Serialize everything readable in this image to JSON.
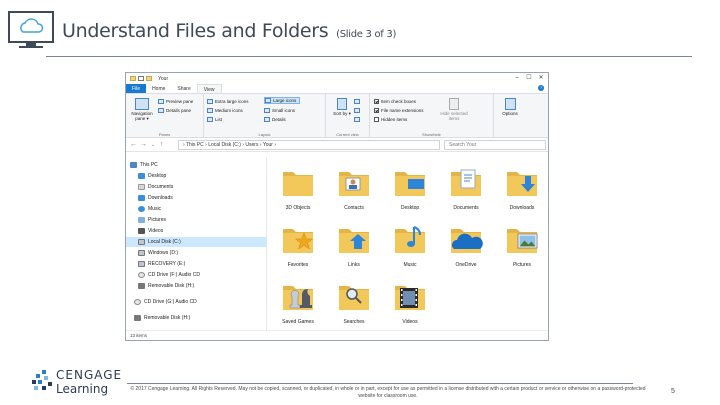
{
  "slide": {
    "title": "Understand Files and Folders",
    "subtitle": "(Slide 3 of 3)",
    "page_number": "5"
  },
  "footer": {
    "logo_top": "CENGAGE",
    "logo_bottom": "Learning",
    "copyright": "© 2017 Cengage Learning. All Rights Reserved. May not be copied, scanned, or duplicated, in whole or in part, except for use as permitted in a license distributed with a certain product or service or otherwise on a password-protected website for classroom use."
  },
  "window": {
    "title": "Your",
    "tabs": [
      "File",
      "Home",
      "Share",
      "View"
    ],
    "active_tab": "View",
    "ribbon": {
      "panes_group": "Panes",
      "navigation_pane": "Navigation pane ▾",
      "preview_pane": "Preview pane",
      "details_pane": "Details pane",
      "layout_group": "Layout",
      "layout_items": [
        "Extra large icons",
        "Large icons",
        "Medium icons",
        "Small icons",
        "List",
        "Details"
      ],
      "current_view_group": "Current view",
      "sort_by": "Sort by ▾",
      "show_hide_group": "Show/hide",
      "item_check_boxes": "Item check boxes",
      "file_name_extensions": "File name extensions",
      "hidden_items": "Hidden items",
      "hide_selected": "Hide selected items",
      "options": "Options"
    },
    "address": "›  This PC  ›  Local Disk (C:)  ›  Users  ›  Your  ›",
    "search_placeholder": "Search Your",
    "nav_tree": [
      "This PC",
      "Desktop",
      "Documents",
      "Downloads",
      "Music",
      "Pictures",
      "Videos",
      "Local Disk (C:)",
      "Windows (D:)",
      "RECOVERY (E:)",
      "CD Drive (F:) Audio CD",
      "Removable Disk (H:)",
      "CD Drive (G:) Audio CD",
      "Removable Disk (H:)"
    ],
    "selected_tree_item": "Local Disk (C:)",
    "items": [
      "3D Objects",
      "Contacts",
      "Desktop",
      "Documents",
      "Downloads",
      "Favorites",
      "Links",
      "Music",
      "OneDrive",
      "Pictures",
      "Saved Games",
      "Searches",
      "Videos"
    ],
    "status": "13 items"
  },
  "colors": {
    "accent": "#1979ca",
    "folder": "#f3c85a",
    "selection": "#cce8ff"
  }
}
